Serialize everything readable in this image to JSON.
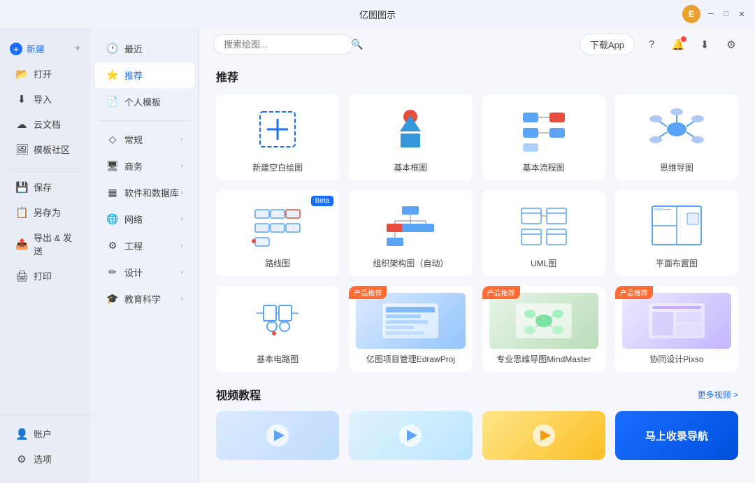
{
  "titleBar": {
    "title": "亿图图示",
    "avatarLabel": "E",
    "minBtn": "─",
    "maxBtn": "□",
    "closeBtn": "✕"
  },
  "leftSidebar": {
    "newLabel": "新建",
    "openLabel": "打开",
    "importLabel": "导入",
    "cloudLabel": "云文档",
    "templateLabel": "模板社区",
    "saveLabel": "保存",
    "saveAsLabel": "另存为",
    "exportLabel": "导出 & 发送",
    "printLabel": "打印",
    "accountLabel": "账户",
    "settingsLabel": "选项"
  },
  "midNav": {
    "recentLabel": "最近",
    "recommendLabel": "推荐",
    "personalLabel": "个人模板",
    "generalLabel": "常规",
    "businessLabel": "商务",
    "softwareLabel": "软件和数据库",
    "networkLabel": "网络",
    "engineeringLabel": "工程",
    "designLabel": "设计",
    "educationLabel": "教育科学"
  },
  "topBar": {
    "searchPlaceholder": "搜索绘图...",
    "downloadBtn": "下载App"
  },
  "mainContent": {
    "recommendTitle": "推荐",
    "videoTitle": "视频教程",
    "moreVideos": "更多视频 >",
    "templates": [
      {
        "id": "new-blank",
        "label": "新建空白绘图",
        "type": "new"
      },
      {
        "id": "basic-frame",
        "label": "基本框图",
        "type": "frame"
      },
      {
        "id": "basic-flow",
        "label": "基本流程图",
        "type": "flow"
      },
      {
        "id": "mindmap",
        "label": "思维导图",
        "type": "mindmap"
      },
      {
        "id": "route",
        "label": "路线图",
        "type": "route",
        "beta": true
      },
      {
        "id": "org-chart",
        "label": "组织架构图（自动）",
        "type": "org"
      },
      {
        "id": "uml",
        "label": "UML图",
        "type": "uml"
      },
      {
        "id": "floor-plan",
        "label": "平面布置图",
        "type": "floor"
      },
      {
        "id": "circuit",
        "label": "基本电路图",
        "type": "circuit"
      },
      {
        "id": "edrawproj",
        "label": "亿图项目管理EdrawProj",
        "type": "product",
        "badge": "产品推荐"
      },
      {
        "id": "mindmaster",
        "label": "专业思维导图MindMaster",
        "type": "product",
        "badge": "产品推荐"
      },
      {
        "id": "pixso",
        "label": "协同设计Pixso",
        "type": "product",
        "badge": "产品推荐"
      }
    ],
    "ctaLabel": "马上收录导航"
  }
}
